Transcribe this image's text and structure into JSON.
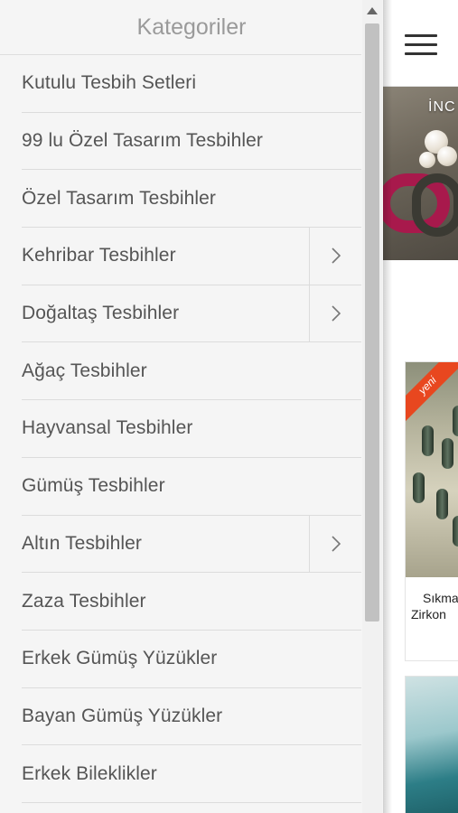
{
  "drawer": {
    "title": "Kategoriler",
    "items": [
      {
        "label": "Kutulu Tesbih Setleri",
        "has_submenu": false
      },
      {
        "label": "99 lu Özel Tasarım Tesbihler",
        "has_submenu": false
      },
      {
        "label": "Özel Tasarım Tesbihler",
        "has_submenu": false
      },
      {
        "label": "Kehribar Tesbihler",
        "has_submenu": true
      },
      {
        "label": "Doğaltaş Tesbihler",
        "has_submenu": true
      },
      {
        "label": "Ağaç Tesbihler",
        "has_submenu": false
      },
      {
        "label": "Hayvansal Tesbihler",
        "has_submenu": false
      },
      {
        "label": "Gümüş Tesbihler",
        "has_submenu": false
      },
      {
        "label": "Altın Tesbihler",
        "has_submenu": true
      },
      {
        "label": "Zaza Tesbihler",
        "has_submenu": false
      },
      {
        "label": "Erkek Gümüş Yüzükler",
        "has_submenu": false
      },
      {
        "label": "Bayan Gümüş Yüzükler",
        "has_submenu": false
      },
      {
        "label": "Erkek Bileklikler",
        "has_submenu": false
      }
    ]
  },
  "page": {
    "menu_icon": "hamburger-icon",
    "banner_text": "İNC",
    "products": [
      {
        "badge": "yeni",
        "title_line1": "Sıkma",
        "title_line2": "Zirkon"
      },
      {
        "badge": "",
        "title_line1": "",
        "title_line2": ""
      }
    ]
  },
  "colors": {
    "drawer_bg": "#f5f5f5",
    "title_gray": "#9a9a9a",
    "item_text": "#555555",
    "badge_orange": "#e8471f"
  }
}
